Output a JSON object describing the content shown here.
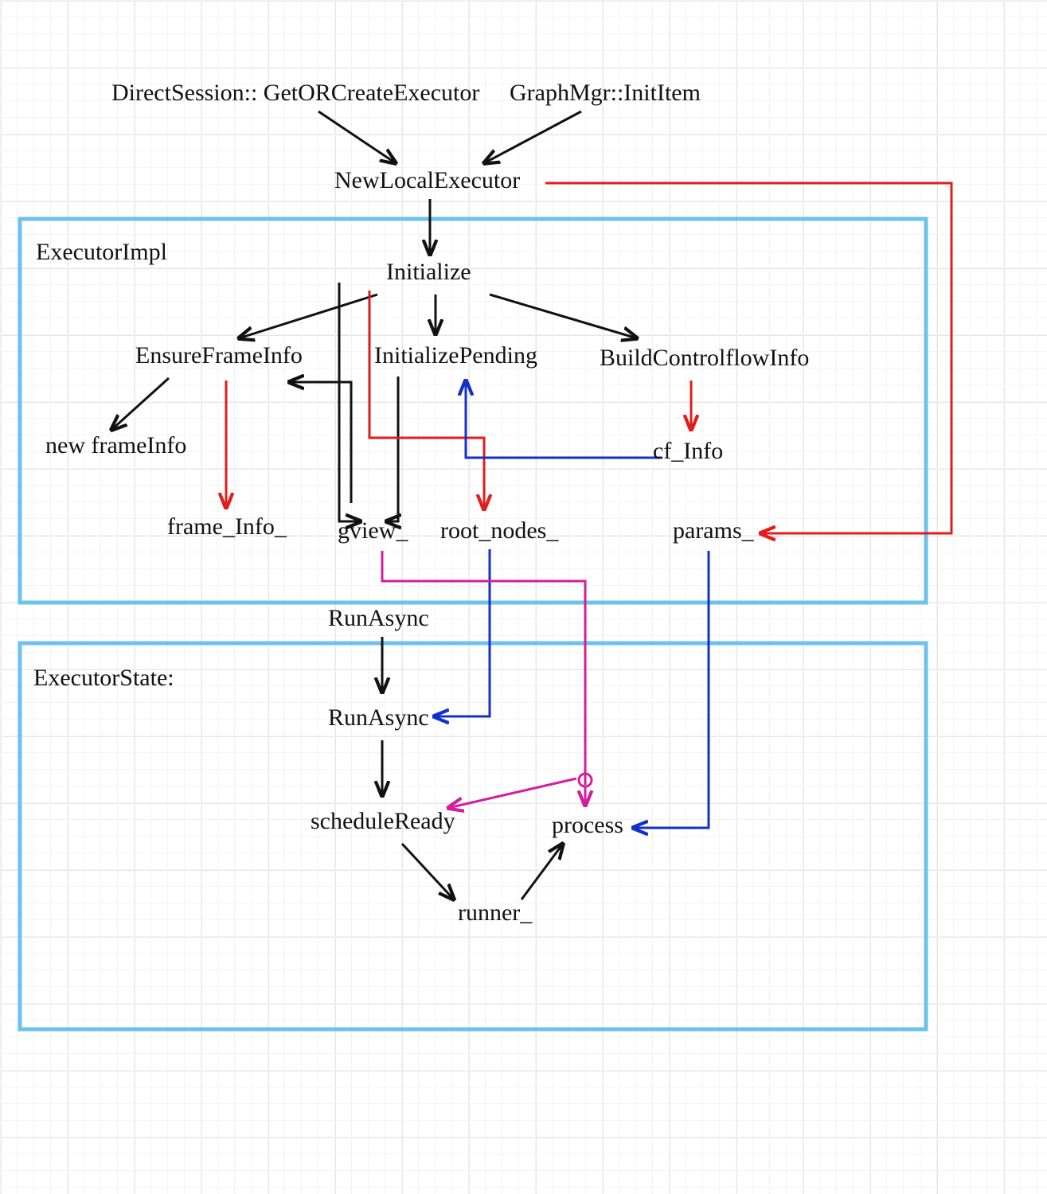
{
  "nodes": {
    "direct_session": "DirectSession:: GetORCreateExecutor",
    "graph_mgr": "GraphMgr::InitItem",
    "new_local_exec": "NewLocalExecutor",
    "initialize": "Initialize",
    "ensure_frame_info": "EnsureFrameInfo",
    "initialize_pending": "InitializePending",
    "build_cf_info": "BuildControlflowInfo",
    "new_frame_info": "new frameInfo",
    "cf_info": "cf_Info",
    "frame_info_": "frame_Info_",
    "gview_": "gview_",
    "root_nodes_": "root_nodes_",
    "params_": "params_",
    "run_async_impl": "RunAsync",
    "run_async_state": "RunAsync",
    "schedule_ready": "scheduleReady",
    "runner_": "runner_",
    "process": "process"
  },
  "boxes": {
    "executor_impl": "ExecutorImpl",
    "executor_state": "ExecutorState:"
  },
  "colors": {
    "box": "#6cc1ee",
    "arrow_black": "#111111",
    "arrow_red": "#e11d1d",
    "arrow_blue": "#1330c9",
    "arrow_magenta": "#d11f9b"
  }
}
